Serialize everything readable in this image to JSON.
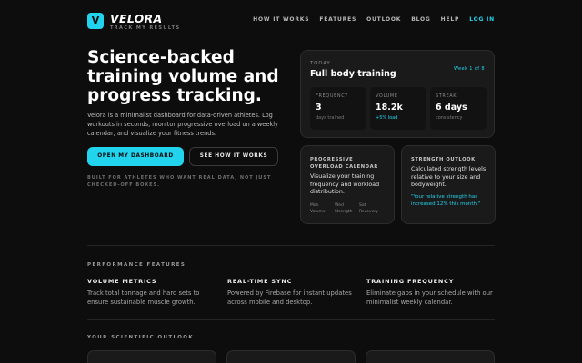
{
  "nav": {
    "logo_letter": "V",
    "brand": "VELORA",
    "tagline": "TRACK MY RESULTS",
    "links": [
      "HOW IT WORKS",
      "FEATURES",
      "OUTLOOK",
      "BLOG",
      "HELP"
    ],
    "login": "LOG IN"
  },
  "hero": {
    "title": "Science-backed training volume and progress tracking.",
    "description": "Velora is a minimalist dashboard for data-driven athletes. Log workouts in seconds, monitor progressive overload on a weekly calendar, and visualize your fitness trends.",
    "primary_button": "OPEN MY DASHBOARD",
    "secondary_button": "SEE HOW IT WORKS",
    "note": "BUILT FOR ATHLETES WHO WANT REAL DATA, NOT JUST CHECKED-OFF BOXES."
  },
  "today_card": {
    "label": "TODAY",
    "title": "Full body training",
    "week": "Week 1 of 8",
    "stats": [
      {
        "label": "FREQUENCY",
        "value": "3",
        "sub": "days trained"
      },
      {
        "label": "VOLUME",
        "value": "18.2k",
        "sub": "+5% load"
      },
      {
        "label": "STREAK",
        "value": "6 days",
        "sub": "consistency"
      }
    ]
  },
  "overload_card": {
    "title": "PROGRESSIVE OVERLOAD CALENDAR",
    "text": "Visualize your training frequency and workload distribution.",
    "legend": [
      "Mon Volume",
      "Wed Strength",
      "Sat Recovery"
    ]
  },
  "outlook_card": {
    "title": "STRENGTH OUTLOOK",
    "text": "Calculated strength levels relative to your size and bodyweight.",
    "quote": "\"Your relative strength has increased 12% this month.\""
  },
  "features": {
    "section_label": "PERFORMANCE FEATURES",
    "items": [
      {
        "title": "VOLUME METRICS",
        "text": "Track total tonnage and hard sets to ensure sustainable muscle growth."
      },
      {
        "title": "REAL-TIME SYNC",
        "text": "Powered by Firebase for instant updates across mobile and desktop."
      },
      {
        "title": "TRAINING FREQUENCY",
        "text": "Eliminate gaps in your schedule with our minimalist weekly calendar."
      }
    ]
  },
  "outlook_section": {
    "section_label": "YOUR SCIENTIFIC OUTLOOK"
  },
  "colors": {
    "accent": "#22d3ee",
    "background": "#0d0d0d",
    "card": "#1a1a1a"
  }
}
